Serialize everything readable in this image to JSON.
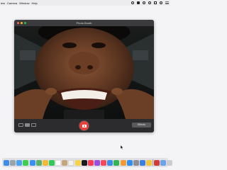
{
  "menubar": {
    "app_menu": "iew",
    "items": [
      "Camera",
      "Window",
      "Help"
    ]
  },
  "window": {
    "title": "Photo Booth",
    "effects_label": "Effects"
  },
  "colors": {
    "shutter": "#e8403b",
    "close": "#ff5f57",
    "minimize": "#febc2e",
    "zoom": "#28c840"
  },
  "dock": {
    "apps": [
      {
        "name": "finder-icon",
        "color": "#3b8ee8"
      },
      {
        "name": "launchpad-icon",
        "color": "#9aa3ad"
      },
      {
        "name": "safari-icon",
        "color": "#4aa3f0"
      },
      {
        "name": "messages-icon",
        "color": "#3fcf4e"
      },
      {
        "name": "mail-icon",
        "color": "#3a8ff0"
      },
      {
        "name": "maps-icon",
        "color": "#57b36a"
      },
      {
        "name": "photos-icon",
        "color": "#f5b83a"
      },
      {
        "name": "facetime-icon",
        "color": "#34c759"
      },
      {
        "name": "calendar-icon",
        "color": "#ffffff"
      },
      {
        "name": "contacts-icon",
        "color": "#c7a57a"
      },
      {
        "name": "reminders-icon",
        "color": "#f2f2f2"
      },
      {
        "name": "notes-icon",
        "color": "#f7d34a"
      },
      {
        "name": "tv-icon",
        "color": "#1c1c1e"
      },
      {
        "name": "music-icon",
        "color": "#fa3c55"
      },
      {
        "name": "podcasts-icon",
        "color": "#9b4de0"
      },
      {
        "name": "news-icon",
        "color": "#f44a5a"
      },
      {
        "name": "keynote-icon",
        "color": "#3d8ae8"
      },
      {
        "name": "numbers-icon",
        "color": "#33b553"
      },
      {
        "name": "pages-icon",
        "color": "#f29a33"
      },
      {
        "name": "app-store-icon",
        "color": "#2f8ff0"
      },
      {
        "name": "system-preferences-icon",
        "color": "#8e8e93"
      },
      {
        "name": "xcode-icon",
        "color": "#3b7fe0"
      },
      {
        "name": "python-icon",
        "color": "#f2c53d"
      },
      {
        "name": "photo-booth-icon",
        "color": "#d23b36"
      },
      {
        "name": "preview-icon",
        "color": "#6aa4e8"
      },
      {
        "name": "trash-icon",
        "color": "#c9ccd1"
      }
    ]
  }
}
